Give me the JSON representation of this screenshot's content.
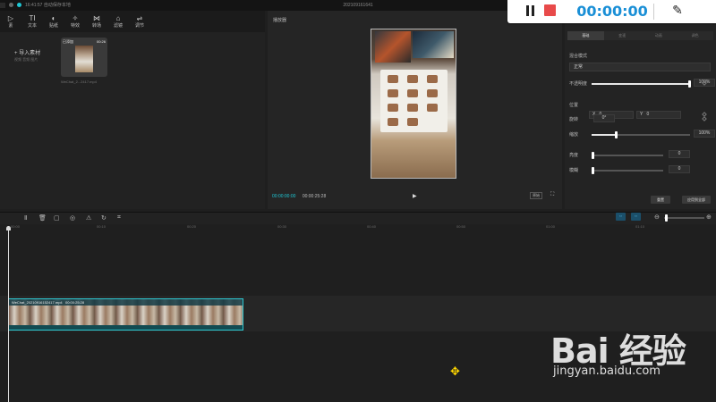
{
  "titlebar": {
    "left_text": "16:41:57 自动保存本地",
    "project_name": "202109161641"
  },
  "recorder": {
    "time": "00:00:00",
    "pause_icon": "pause-icon",
    "stop_icon": "stop-icon",
    "pen_icon": "pen-icon",
    "stop_color": "#e84a4a",
    "time_color": "#1a8fd6"
  },
  "media": {
    "tools": [
      {
        "icon": "▷",
        "label": "素"
      },
      {
        "icon": "TI",
        "label": "文本"
      },
      {
        "icon": "◐",
        "label": "贴纸"
      },
      {
        "icon": "✧",
        "label": "特效"
      },
      {
        "icon": "⋈",
        "label": "转场"
      },
      {
        "icon": "⌂",
        "label": "滤镜"
      },
      {
        "icon": "⇌",
        "label": "调节"
      }
    ],
    "import_label": "+ 导入素材",
    "import_sub": "视频  音频  图片",
    "thumb_label": "已添加",
    "thumb_duration": "00:26",
    "thumb_name": "WeChat_2...2417.mp4"
  },
  "player": {
    "title": "播放器",
    "current_time": "00:00:00:00",
    "total_time": "00:00:25:28",
    "play_icon": "▶",
    "ratio_label": "原始",
    "fullscreen_icon": "⛶"
  },
  "properties": {
    "tabs": [
      "基础",
      "变速",
      "动画",
      "调色"
    ],
    "blend_label": "混合模式",
    "blend_value": "正常",
    "opacity_label": "不透明度",
    "opacity_value": "100%",
    "opacity_level": 1.0,
    "position_label": "位置",
    "pos_x_label": "X",
    "pos_x": "0",
    "pos_y_label": "Y",
    "pos_y": "0",
    "rotate_label": "旋转",
    "rotate_value": "0°",
    "scale_label": "缩放",
    "scale_value": "100%",
    "scale_level": 0.25,
    "shine_label": "亮度",
    "shine_value": "0",
    "shine_level": 0.0,
    "blur_label": "模糊",
    "blur_value": "0",
    "blur_level": 0.0,
    "reset_label": "重置",
    "apply_all_label": "应用到全部"
  },
  "timeline": {
    "tools": [
      "Ⅱ",
      "🗑",
      "▢",
      "◎",
      "⚠",
      "↻",
      "⌗"
    ],
    "ticks": [
      "00:00",
      "00:10",
      "00:20",
      "00:30",
      "00:40",
      "00:50",
      "01:00",
      "01:10"
    ],
    "clip_label": "WeChat_20210916152417.mp4",
    "clip_duration": "00:00:25:28",
    "clip_color": "#2ec7d0"
  },
  "watermark": {
    "logo": "Bai 经验",
    "url": "jingyan.baidu.com"
  }
}
